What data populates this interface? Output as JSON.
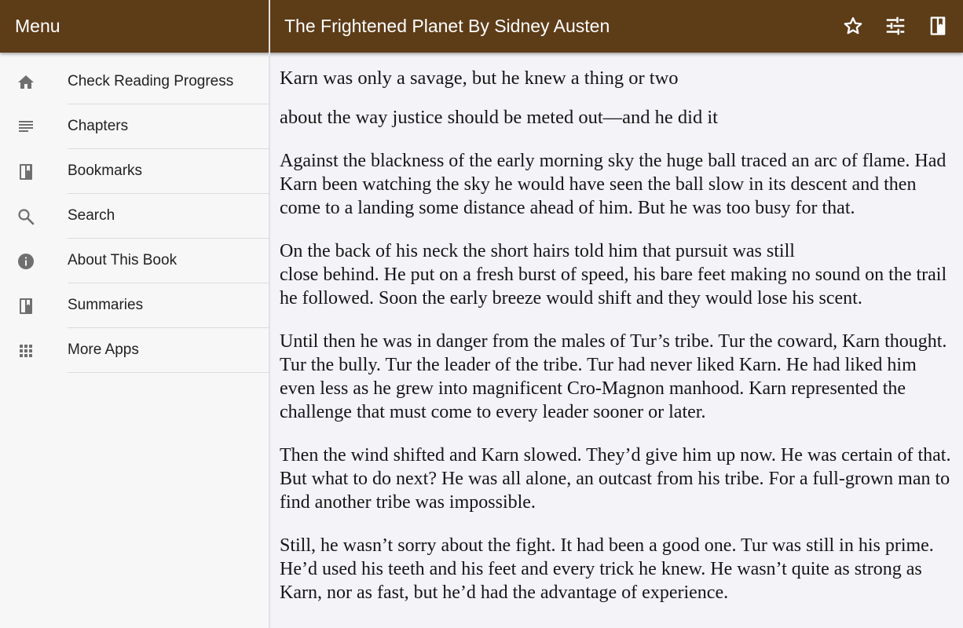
{
  "header": {
    "menu_title": "Menu",
    "book_title": "The Frightened Planet By Sidney Austen",
    "icons": [
      "star-outline-icon",
      "tune-sliders-icon",
      "book-icon"
    ]
  },
  "colors": {
    "header_background": "#5d3c18",
    "sidebar_background": "#f7f7f7",
    "content_background": "#f3f3f8",
    "icon_gray": "#6f6f6f"
  },
  "sidebar": {
    "items": [
      {
        "label": "Check Reading Progress",
        "icon": "home-icon"
      },
      {
        "label": "Chapters",
        "icon": "chapters-list-icon"
      },
      {
        "label": "Bookmarks",
        "icon": "book-icon"
      },
      {
        "label": "Search",
        "icon": "search-icon"
      },
      {
        "label": "About This Book",
        "icon": "info-icon"
      },
      {
        "label": "Summaries",
        "icon": "book-icon"
      },
      {
        "label": "More Apps",
        "icon": "apps-grid-icon"
      }
    ]
  },
  "content": {
    "heading_line1": "Karn was only a savage, but he knew a thing or two",
    "heading_line2": "about the way justice should be meted out—and he did it",
    "paragraphs": [
      "Against the blackness of the early morning sky the huge ball traced an arc of flame. Had Karn been watching the sky he would have seen the ball slow in its descent and then come to a landing some distance ahead of him. But he was too busy for that.",
      "On the back of his neck the short hairs told him that pursuit was still",
      "close behind. He put on a fresh burst of speed, his bare feet making no sound on the trail he followed. Soon the early breeze would shift and they would lose his scent.",
      "Until then he was in danger from the males of Tur’s tribe. Tur the coward, Karn thought. Tur the bully. Tur the leader of the tribe. Tur had never liked Karn. He had liked him even less as he grew into magnificent Cro-Magnon manhood. Karn represented the challenge that must come to every leader sooner or later.",
      "Then the wind shifted and Karn slowed. They’d give him up now. He was certain of that. But what to do next? He was all alone, an outcast from his tribe. For a full-grown man to find another tribe was impossible.",
      "Still, he wasn’t sorry about the fight. It had been a good one. Tur was still in his prime. He’d used his teeth and his feet and every trick he knew. He wasn’t quite as strong as Karn, nor as fast, but he’d had the advantage of experience."
    ]
  }
}
